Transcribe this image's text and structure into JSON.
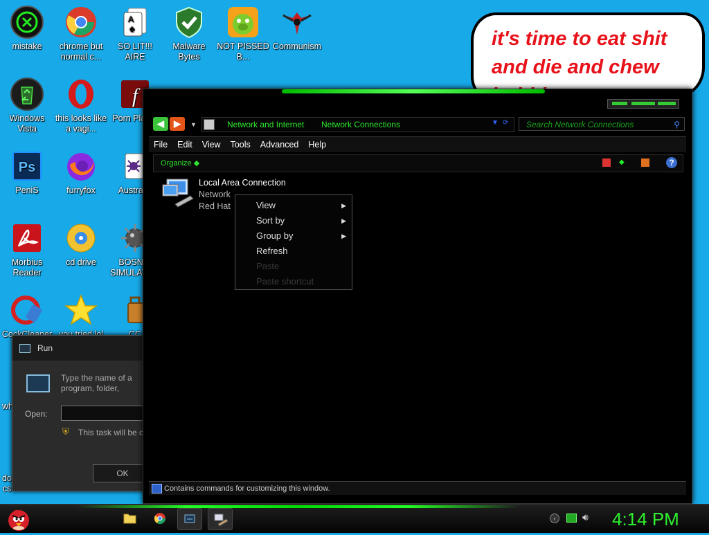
{
  "desktop": {
    "icons": [
      {
        "label": "mistake",
        "icon": "razer-icon"
      },
      {
        "label": "chrome but normal c...",
        "icon": "chrome-icon"
      },
      {
        "label": "SO LIT!!! AIRE",
        "icon": "solitaire-icon"
      },
      {
        "label": "Malware Bytes",
        "icon": "shield-check-icon"
      },
      {
        "label": "NOT PISSED B...",
        "icon": "angry-pig-icon"
      },
      {
        "label": "Communism",
        "icon": "emblem-icon"
      },
      {
        "label": "Windows Vista",
        "icon": "recycle-bin-icon"
      },
      {
        "label": "this looks like a vagi...",
        "icon": "opera-icon"
      },
      {
        "label": "Porn Player",
        "icon": "flash-icon"
      },
      {
        "label": "PeniS",
        "icon": "photoshop-icon"
      },
      {
        "label": "furryfox",
        "icon": "firefox-icon"
      },
      {
        "label": "Australia",
        "icon": "spider-solitaire-icon"
      },
      {
        "label": "Morbius Reader",
        "icon": "acrobat-icon"
      },
      {
        "label": "cd drive",
        "icon": "cd-icon"
      },
      {
        "label": "BOSNIA SIMULATOR",
        "icon": "mine-icon"
      },
      {
        "label": "CockCleaner",
        "icon": "ccleaner-icon"
      },
      {
        "label": "you tried lol",
        "icon": "star-icon"
      },
      {
        "label": "CC",
        "icon": "briefcase-icon"
      },
      {
        "label": "wh",
        "icon": "unknown-icon"
      },
      {
        "label": "docs",
        "icon": "unknown-icon"
      }
    ]
  },
  "bubble": {
    "text": "it's time to eat shit and die and chew bubble gum"
  },
  "run_dialog": {
    "title": "Run",
    "description": "Type the name of a program, folder, document, or Internet resource, and Windows will open it for you.",
    "open_label": "Open:",
    "open_value": "",
    "note": "This task will be created with administrative privileges.",
    "ok_label": "OK"
  },
  "explorer": {
    "breadcrumb": [
      "Network and Internet",
      "Network Connections"
    ],
    "search_placeholder": "Search Network Connections",
    "menu": [
      "File",
      "Edit",
      "View",
      "Tools",
      "Advanced",
      "Help"
    ],
    "organize_label": "Organize",
    "connection": {
      "name": "Local Area Connection",
      "line2": "Network",
      "line3": "Red Hat"
    },
    "context_menu": [
      {
        "label": "View",
        "submenu": true,
        "enabled": true
      },
      {
        "label": "Sort by",
        "submenu": true,
        "enabled": true
      },
      {
        "label": "Group by",
        "submenu": true,
        "enabled": true
      },
      {
        "label": "Refresh",
        "submenu": false,
        "enabled": true
      },
      {
        "label": "Paste",
        "submenu": false,
        "enabled": false
      },
      {
        "label": "Paste shortcut",
        "submenu": false,
        "enabled": false
      }
    ],
    "status": "Contains commands for customizing this window."
  },
  "taskbar": {
    "clock": "4:14 PM"
  },
  "colors": {
    "desktop": "#17a9e8",
    "accent_green": "#2ee62e",
    "bubble_text": "#e8121a"
  }
}
